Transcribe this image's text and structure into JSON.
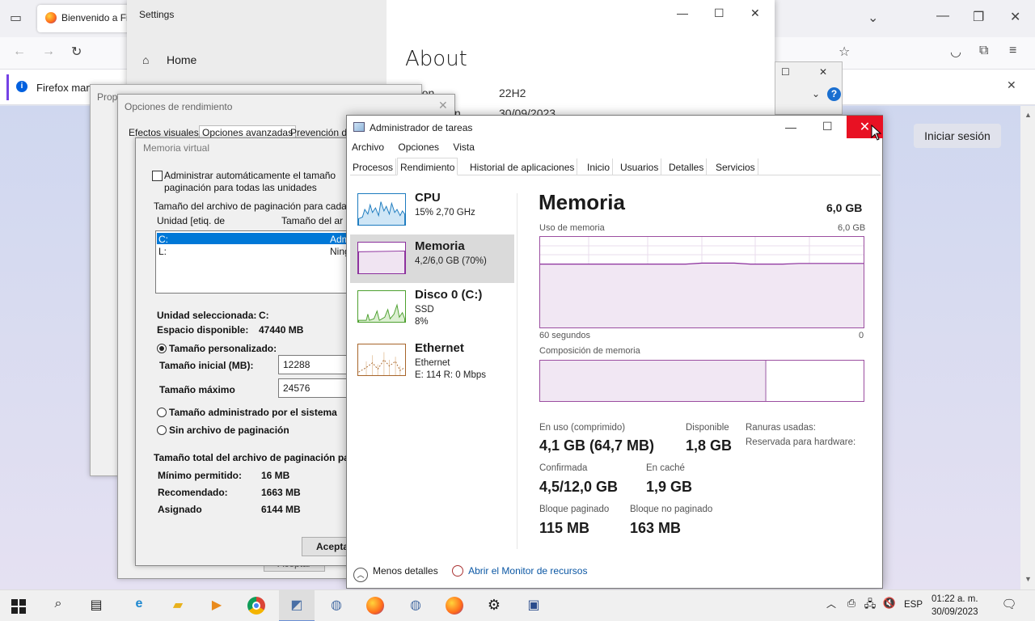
{
  "firefox": {
    "tab_title": "Bienvenido a Fi",
    "notice_text": "Firefox mane",
    "signin_label": "Iniciar sesión"
  },
  "settings": {
    "title": "Settings",
    "home": "Home",
    "page_title": "About",
    "version_label": "rsion",
    "version_value": "22H2",
    "installed_label": "n",
    "installed_value": "30/09/2023"
  },
  "props": {
    "title": "Prop"
  },
  "perf": {
    "title": "Opciones de rendimiento",
    "tabs": [
      "Efectos visuales",
      "Opciones avanzadas",
      "Prevención de"
    ],
    "ok_label": "Aceptar"
  },
  "vm": {
    "title": "Memoria virtual",
    "auto_label_1": "Administrar automáticamente el tamaño",
    "auto_label_2": "paginación para todas las unidades",
    "group1": "Tamaño del archivo de paginación para cada",
    "col1": "Unidad [etiq. de",
    "col2": "Tamaño del ar",
    "drives": [
      {
        "name": "C:",
        "value": "Admi"
      },
      {
        "name": "L:",
        "value": "Ning"
      }
    ],
    "selected_label": "Unidad seleccionada:",
    "selected_value": "C:",
    "space_label": "Espacio disponible:",
    "space_value": "47440 MB",
    "custom_label": "Tamaño personalizado:",
    "initial_label": "Tamaño inicial (MB):",
    "initial_value": "12288",
    "max_label": "Tamaño máximo",
    "max_value": "24576",
    "system_label": "Tamaño administrado por el sistema",
    "none_label": "Sin archivo de paginación",
    "group2": "Tamaño total del archivo de paginación para",
    "min_label": "Mínimo permitido:",
    "min_value": "16 MB",
    "rec_label": "Recomendado:",
    "rec_value": "1663 MB",
    "asg_label": "Asignado",
    "asg_value": "6144 MB",
    "ok_label": "Acepta"
  },
  "taskmgr": {
    "title": "Administrador de tareas",
    "menu": [
      "Archivo",
      "Opciones",
      "Vista"
    ],
    "tabs": [
      "Procesos",
      "Rendimiento",
      "Historial de aplicaciones",
      "Inicio",
      "Usuarios",
      "Detalles",
      "Servicios"
    ],
    "resources": [
      {
        "name": "CPU",
        "line1": "15%  2,70 GHz",
        "line2": "",
        "line3": "",
        "color": "#1c7bbf"
      },
      {
        "name": "Memoria",
        "line1": "4,2/6,0 GB (70%)",
        "line2": "",
        "line3": "",
        "color": "#8b2e9c"
      },
      {
        "name": "Disco 0 (C:)",
        "line1": "SSD",
        "line2": "8%",
        "line3": "",
        "color": "#4da02f"
      },
      {
        "name": "Ethernet",
        "line1": "Ethernet",
        "line2": "E: 114  R: 0 Mbps",
        "line3": "",
        "color": "#a7652a"
      }
    ],
    "detail": {
      "title": "Memoria",
      "total": "6,0 GB",
      "usage_label": "Uso de memoria",
      "usage_max": "6,0 GB",
      "time_label": "60 segundos",
      "time_zero": "0",
      "composition_label": "Composición de memoria",
      "in_use_label": "En uso (comprimido)",
      "in_use_value": "4,1 GB (64,7 MB)",
      "available_label": "Disponible",
      "available_value": "1,8 GB",
      "slots_label": "Ranuras usadas:",
      "reserved_label": "Reservada para hardware:",
      "committed_label": "Confirmada",
      "committed_value": "4,5/12,0 GB",
      "cached_label": "En caché",
      "cached_value": "1,9 GB",
      "paged_label": "Bloque paginado",
      "paged_value": "115 MB",
      "nonpaged_label": "Bloque no paginado",
      "nonpaged_value": "163 MB",
      "usage_fraction": 0.7
    },
    "footer_less": "Menos detalles",
    "footer_monitor": "Abrir el Monitor de recursos"
  },
  "taskbar": {
    "lang": "ESP",
    "time": "01:22 a. m.",
    "date": "30/09/2023"
  }
}
